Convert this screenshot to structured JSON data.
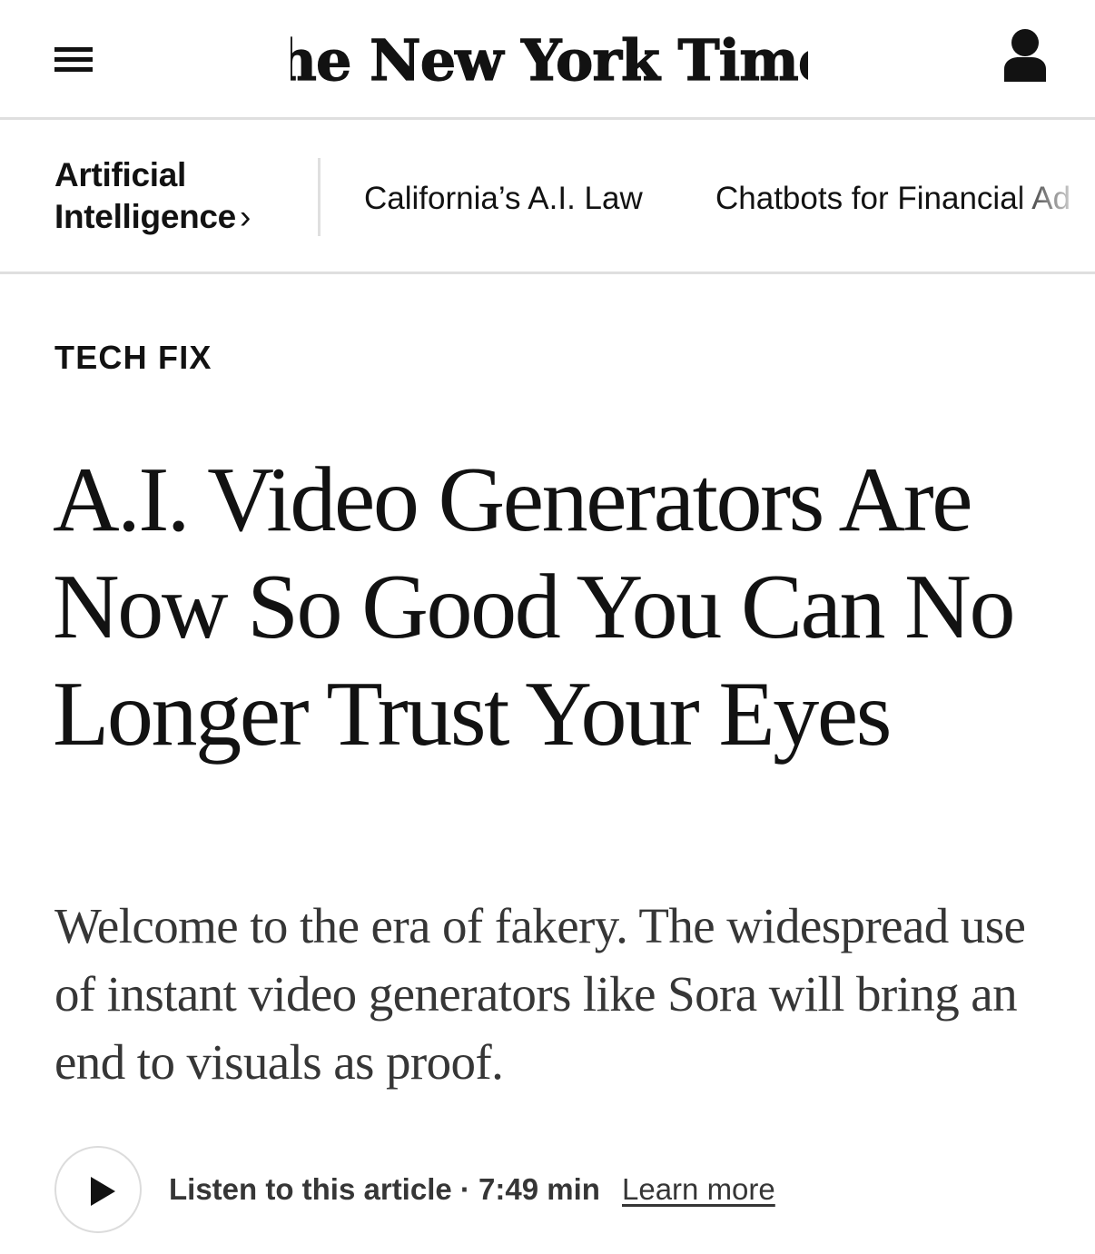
{
  "masthead": {
    "logo_text": "The New York Times",
    "menu_icon": "hamburger-menu-icon",
    "account_icon": "user-account-icon"
  },
  "section_bar": {
    "section_line1": "Artificial",
    "section_line2": "Intelligence",
    "section_chevron": "›",
    "related": [
      "California’s A.I. Law",
      "Chatbots for Financial Ad"
    ]
  },
  "article": {
    "kicker": "TECH FIX",
    "headline": "A.I. Video Generators Are Now So Good You Can No Longer Trust Your Eyes",
    "summary": "Welcome to the era of fakery. The widespread use of instant video generators like Sora will bring an end to visuals as proof."
  },
  "listen": {
    "play_icon": "play-icon",
    "label": "Listen to this article · 7:49 min",
    "learn_more": "Learn more"
  }
}
